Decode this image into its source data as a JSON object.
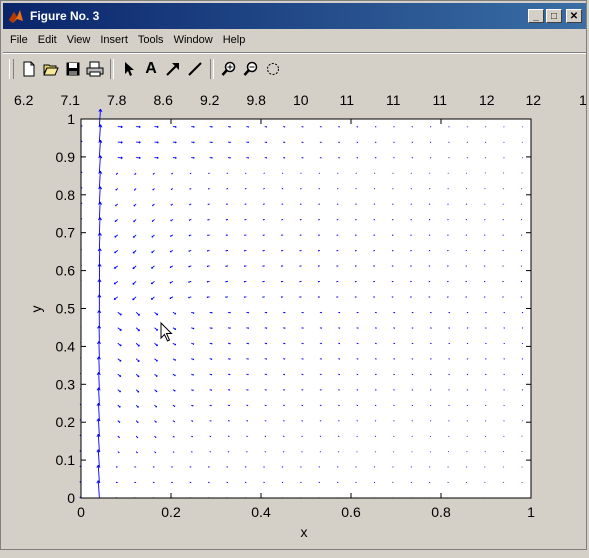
{
  "window": {
    "title": "Figure No. 3",
    "minimize_glyph": "_",
    "maximize_glyph": "□",
    "close_glyph": "✕"
  },
  "menu": [
    "File",
    "Edit",
    "View",
    "Insert",
    "Tools",
    "Window",
    "Help"
  ],
  "toolbar": {
    "tools": [
      "new-icon",
      "open-icon",
      "save-icon",
      "print-icon",
      "select-arrow-icon",
      "text-icon",
      "arrow-icon",
      "line-icon",
      "zoom-in-icon",
      "zoom-out-icon",
      "rotate-icon"
    ],
    "text_tool_glyph": "A"
  },
  "figure": {
    "top_labels": [
      "6.2",
      "7.1",
      "7.8",
      "8.6",
      "9.2",
      "9.8",
      "10",
      "11",
      "11",
      "11",
      "12",
      "12",
      "1"
    ]
  },
  "chart_data": {
    "type": "quiver",
    "xlabel": "x",
    "ylabel": "y",
    "xlim": [
      0,
      1
    ],
    "ylim": [
      0,
      1
    ],
    "xticks": [
      "0",
      "0.2",
      "0.4",
      "0.6",
      "0.8",
      "1"
    ],
    "yticks": [
      "0",
      "0.1",
      "0.2",
      "0.3",
      "0.4",
      "0.5",
      "0.6",
      "0.7",
      "0.8",
      "0.9",
      "1"
    ],
    "grid_n": 25,
    "arrow_color": "#0000ff",
    "description_fields": {
      "boundary_layer_x": 0.035,
      "recirculation": "clockwise"
    }
  }
}
